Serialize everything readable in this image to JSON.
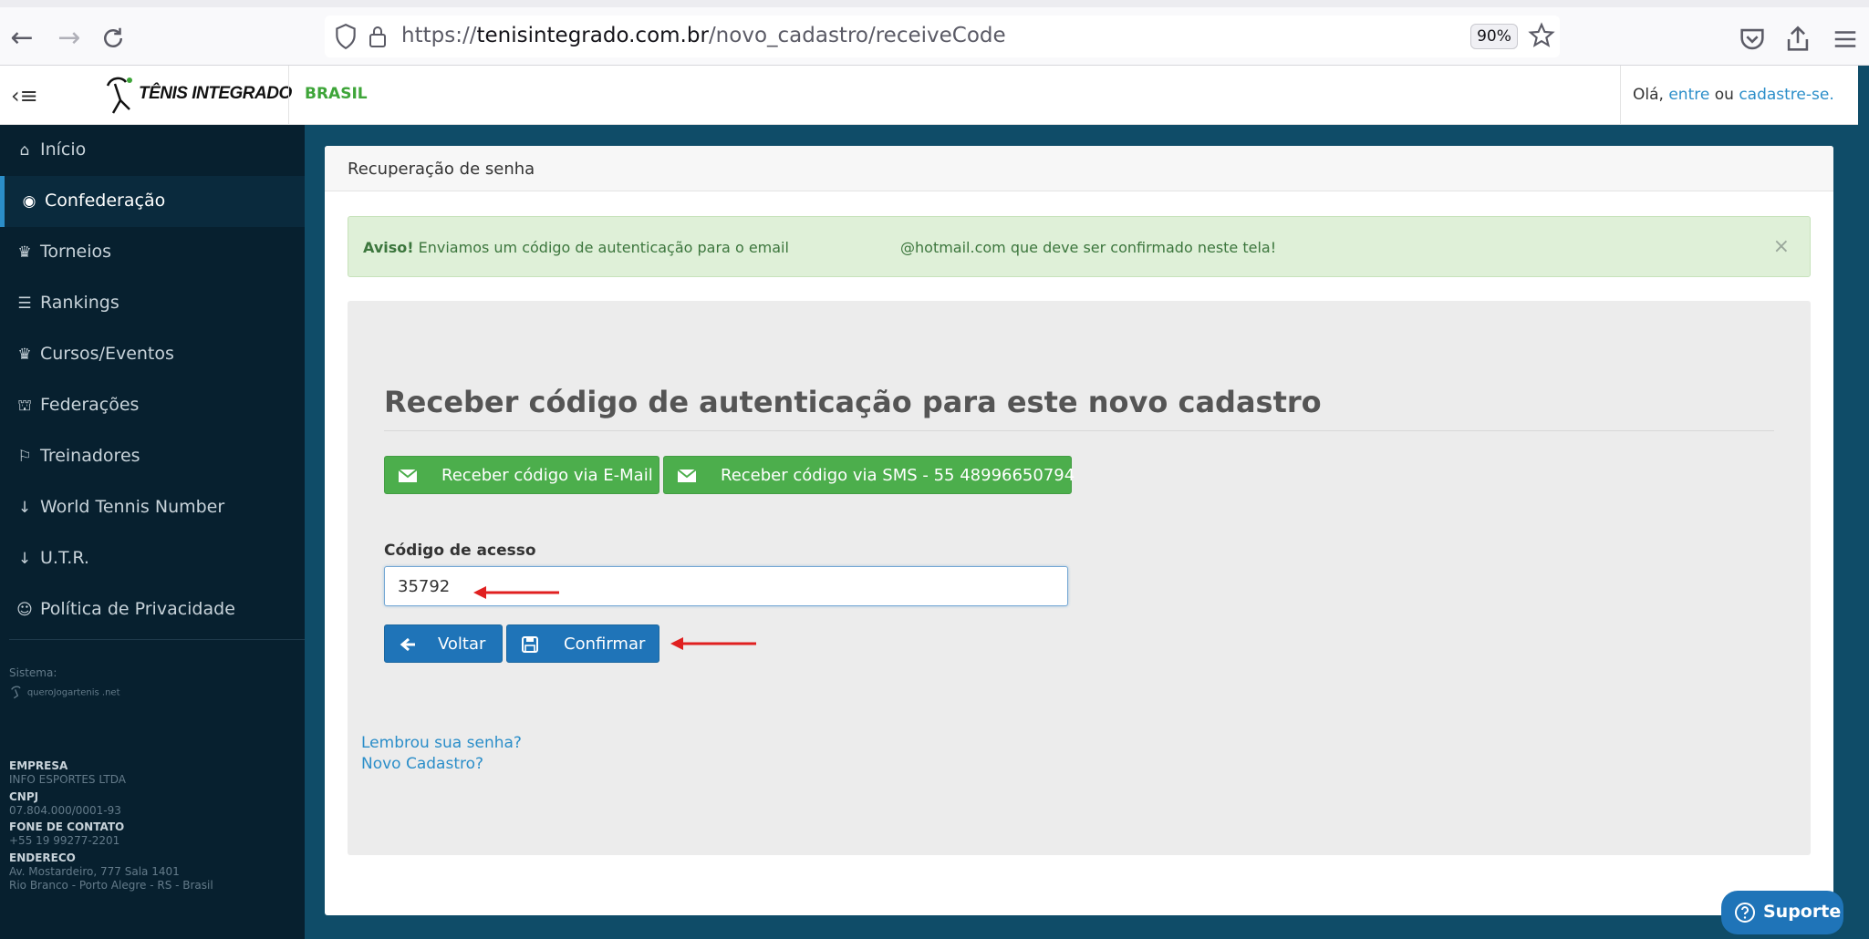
{
  "browser": {
    "url_prefix": "https://",
    "url_domain": "tenisintegrado.com.br",
    "url_path": "/novo_cadastro/receiveCode",
    "zoom": "90%"
  },
  "header": {
    "logo_text": "TÊNIS INTEGRADO",
    "country": "BRASIL",
    "greeting": "Olá, ",
    "login_link": "entre",
    "or_text": " ou ",
    "signup_link": "cadastre-se."
  },
  "sidebar": {
    "items": [
      {
        "label": "Início",
        "icon": "home-icon",
        "glyph": "⌂"
      },
      {
        "label": "Confederação",
        "icon": "globe-icon",
        "glyph": "◉"
      },
      {
        "label": "Torneios",
        "icon": "trophy-icon",
        "glyph": "♛"
      },
      {
        "label": "Rankings",
        "icon": "list-icon",
        "glyph": "☰"
      },
      {
        "label": "Cursos/Eventos",
        "icon": "trophy-icon",
        "glyph": "♛"
      },
      {
        "label": "Federações",
        "icon": "bank-icon",
        "glyph": "⛫"
      },
      {
        "label": "Treinadores",
        "icon": "flag-icon",
        "glyph": "⚐"
      },
      {
        "label": "World Tennis Number",
        "icon": "sort-icon",
        "glyph": "↓"
      },
      {
        "label": "U.T.R.",
        "icon": "sort-icon",
        "glyph": "↓"
      },
      {
        "label": "Política de Privacidade",
        "icon": "users-icon",
        "glyph": "☺"
      }
    ],
    "system_label": "Sistema:",
    "system_logo_text": "queroJogartenis .net",
    "company_label": "EMPRESA",
    "company_value": "INFO ESPORTES LTDA",
    "cnpj_label": "CNPJ",
    "cnpj_value": "07.804.000/0001-93",
    "phone_label": "FONE DE CONTATO",
    "phone_value": "+55 19 99277-2201",
    "address_label": "ENDERECO",
    "address_line1": "Av. Mostardeiro, 777 Sala 1401",
    "address_line2": "Rio Branco - Porto Alegre - RS - Brasil"
  },
  "panel": {
    "title": "Recuperação de senha",
    "alert_bold": "Aviso!",
    "alert_text": " Enviamos um código de autenticação para o email                        @hotmail.com que deve ser confirmado neste tela!",
    "alert_close": "×",
    "heading": "Receber código de autenticação para este novo cadastro",
    "btn_email": "Receber código via E-Mail",
    "btn_sms": "Receber código via SMS - 55 48996650794",
    "code_label": "Código de acesso",
    "code_value": "35792",
    "btn_back": "Voltar",
    "btn_confirm": "Confirmar",
    "link_remember": "Lembrou sua senha?",
    "link_new": "Novo Cadastro?"
  },
  "support": {
    "label": "Suporte"
  },
  "colors": {
    "brand_green": "#4cae4c",
    "brand_blue": "#1f74b8",
    "sidebar_bg": "#07202f",
    "page_bg": "#0f4c68",
    "annotation_red": "#e02020"
  }
}
